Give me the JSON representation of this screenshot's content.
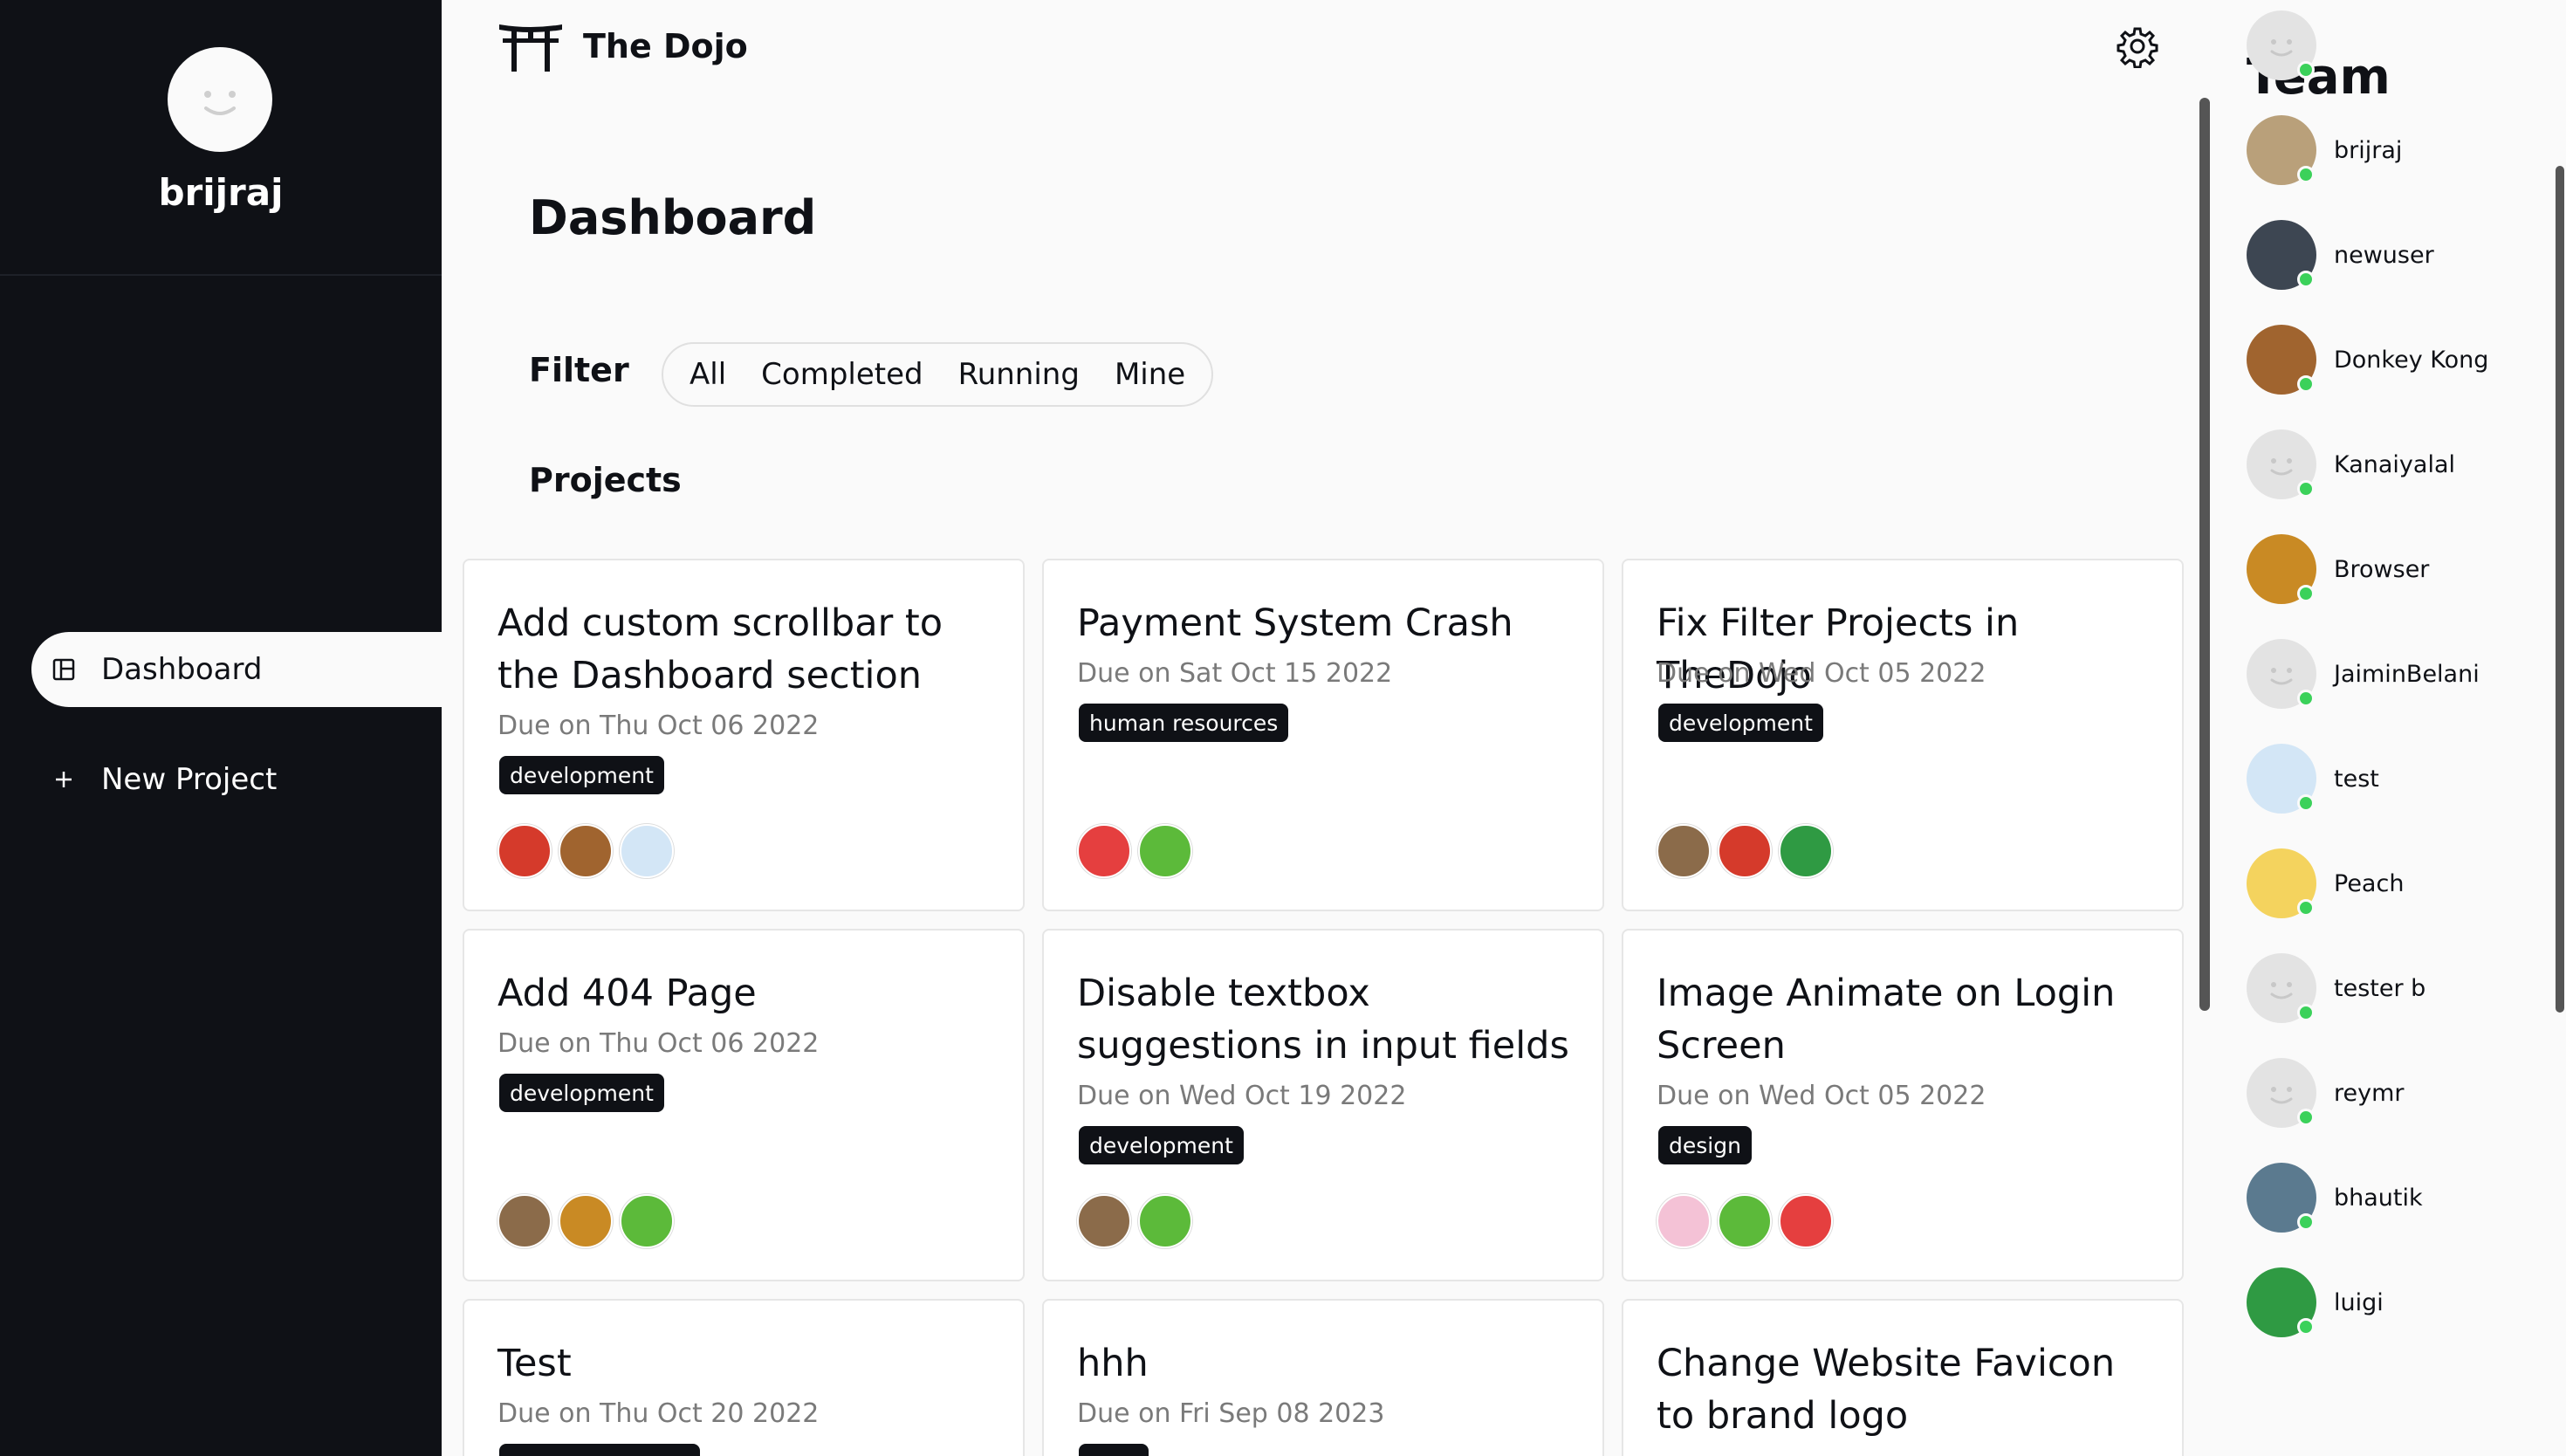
{
  "sidebar": {
    "username": "brijraj",
    "nav": [
      {
        "label": "Dashboard",
        "icon": "dashboard-icon",
        "active": true
      },
      {
        "label": "New Project",
        "icon": "plus-icon",
        "active": false
      }
    ]
  },
  "header": {
    "app_name": "The Dojo",
    "logo_icon": "torii-gate-icon",
    "settings_icon": "gear-icon"
  },
  "main": {
    "title": "Dashboard",
    "filter": {
      "label": "Filter",
      "options": [
        "All",
        "Completed",
        "Running",
        "Mine"
      ]
    },
    "projects_label": "Projects",
    "projects": [
      {
        "title": "Add custom scrollbar to the Dashboard section",
        "due": "Due on Thu Oct 06 2022",
        "tag": "development",
        "members": [
          "#d53a2b",
          "#a0642f",
          "#d3e6f6"
        ]
      },
      {
        "title": "Payment System Crash",
        "due": "Due on Sat Oct 15 2022",
        "tag": "human resources",
        "members": [
          "#e53f3f",
          "#5cba3a"
        ]
      },
      {
        "title": "Fix Filter Projects in TheDojo",
        "due": "Due on Wed Oct 05 2022",
        "tag": "development",
        "members": [
          "#8b6b4a",
          "#d53a2b",
          "#2f9a43"
        ]
      },
      {
        "title": "Add 404 Page",
        "due": "Due on Thu Oct 06 2022",
        "tag": "development",
        "members": [
          "#8b6b4a",
          "#c98a24",
          "#5cba3a"
        ]
      },
      {
        "title": "Disable textbox suggestions in input fields",
        "due": "Due on Wed Oct 19 2022",
        "tag": "development",
        "members": [
          "#8b6b4a",
          "#5cba3a"
        ]
      },
      {
        "title": "Image Animate on Login Screen",
        "due": "Due on Wed Oct 05 2022",
        "tag": "design",
        "members": [
          "#f4c2d6",
          "#5cba3a",
          "#e53f3f"
        ]
      },
      {
        "title": "Test",
        "due": "Due on Thu Oct 20 2022",
        "tag": "",
        "members": []
      },
      {
        "title": "hhh",
        "due": "Due on Fri Sep 08 2023",
        "tag": "",
        "members": []
      },
      {
        "title": "Change Website Favicon to brand logo",
        "due": "",
        "tag": "",
        "members": []
      }
    ]
  },
  "team": {
    "title": "Team",
    "members": [
      {
        "name": "",
        "avatar_color": "#e3e3e3",
        "default_avatar": true,
        "online": true
      },
      {
        "name": "brijraj",
        "avatar_color": "#b9a07a",
        "default_avatar": false,
        "online": true
      },
      {
        "name": "newuser",
        "avatar_color": "#3d4652",
        "default_avatar": false,
        "online": false
      },
      {
        "name": "Donkey Kong",
        "avatar_color": "#a0642f",
        "default_avatar": false,
        "online": true
      },
      {
        "name": "Kanaiyalal",
        "avatar_color": "#e3e3e3",
        "default_avatar": true,
        "online": true
      },
      {
        "name": "Browser",
        "avatar_color": "#c98a24",
        "default_avatar": false,
        "online": false
      },
      {
        "name": "JaiminBelani",
        "avatar_color": "#e3e3e3",
        "default_avatar": true,
        "online": true
      },
      {
        "name": "test",
        "avatar_color": "#d3e6f6",
        "default_avatar": false,
        "online": true
      },
      {
        "name": "Peach",
        "avatar_color": "#f4d35e",
        "default_avatar": false,
        "online": true
      },
      {
        "name": "tester b",
        "avatar_color": "#e3e3e3",
        "default_avatar": true,
        "online": true
      },
      {
        "name": "reymr",
        "avatar_color": "#e3e3e3",
        "default_avatar": true,
        "online": true
      },
      {
        "name": "bhautik",
        "avatar_color": "#5b7a8f",
        "default_avatar": false,
        "online": true
      },
      {
        "name": "luigi",
        "avatar_color": "#2f9a43",
        "default_avatar": false,
        "online": true
      }
    ]
  },
  "colors": {
    "sidebar_bg": "#0f1116",
    "page_bg": "#fafafa",
    "tag_bg": "#0f1116",
    "online": "#3bd15a"
  }
}
